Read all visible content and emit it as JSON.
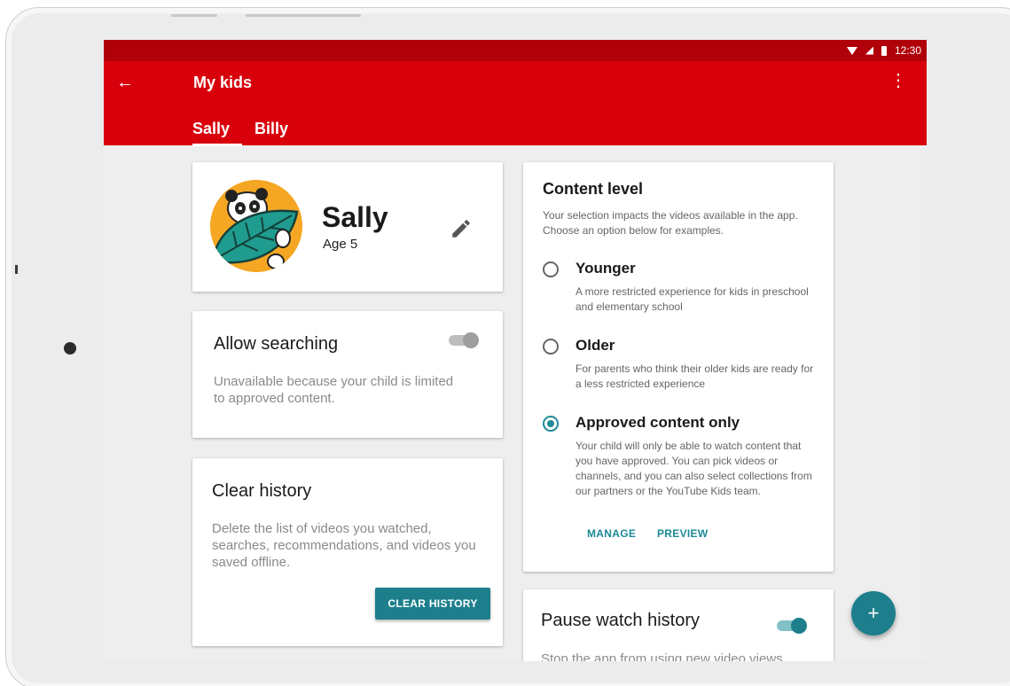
{
  "status_bar": {
    "time": "12:30"
  },
  "app_bar": {
    "title": "My kids",
    "tabs": [
      {
        "label": "Sally",
        "active": true
      },
      {
        "label": "Billy",
        "active": false
      }
    ]
  },
  "profile": {
    "name": "Sally",
    "age": "Age 5"
  },
  "allow_searching": {
    "title": "Allow searching",
    "description": "Unavailable because your child is limited to approved content.",
    "enabled": false,
    "disabled": true
  },
  "clear_history": {
    "title": "Clear history",
    "description": "Delete the list of videos you watched, searches, recommendations, and videos you saved offline.",
    "button_label": "CLEAR HISTORY"
  },
  "content_level": {
    "title": "Content level",
    "intro": "Your selection impacts the videos available in the app. Choose an option below for examples.",
    "options": [
      {
        "label": "Younger",
        "description": "A more restricted experience for kids in preschool and elementary school",
        "selected": false
      },
      {
        "label": "Older",
        "description": "For parents who think their older kids are ready for a less restricted experience",
        "selected": false
      },
      {
        "label": "Approved content only",
        "description": "Your child will only be able to watch content that you have approved. You can pick videos or channels, and you can also select collections from our partners or the YouTube Kids team.",
        "selected": true
      }
    ],
    "manage_label": "MANAGE",
    "preview_label": "PREVIEW"
  },
  "pause_watch_history": {
    "title": "Pause watch history",
    "description": "Stop the app from using new video views",
    "enabled": true
  },
  "fab": {
    "label": "+"
  },
  "colors": {
    "status_bar": "#b0000a",
    "app_bar": "#d8000b",
    "accent": "#1d7f8c",
    "radio_accent": "#1d8a96",
    "avatar_bg": "#f5a623",
    "leaf": "#1f9c8f"
  },
  "icons": {
    "back": "arrow-left-icon",
    "more": "more-vert-icon",
    "edit": "pencil-icon",
    "wifi": "wifi-icon",
    "signal": "cell-signal-icon",
    "battery": "battery-icon",
    "fab": "plus-icon"
  }
}
